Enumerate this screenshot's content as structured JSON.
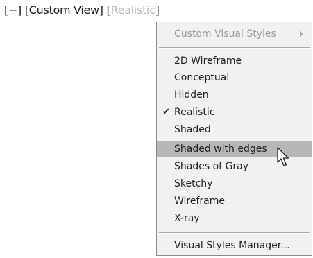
{
  "viewport_controls": {
    "minus": "[−]",
    "view": "[Custom View]",
    "style_open": "[",
    "style_name": "Realistic",
    "style_close": "]"
  },
  "menu": {
    "submenu": {
      "label": "Custom Visual Styles",
      "disabled": true,
      "icon": "chevron-right-icon"
    },
    "items": [
      {
        "label": "2D Wireframe"
      },
      {
        "label": "Conceptual"
      },
      {
        "label": "Hidden"
      },
      {
        "label": "Realistic",
        "checked": true
      },
      {
        "label": "Shaded"
      },
      {
        "label": "Shaded with edges",
        "highlighted": true
      },
      {
        "label": "Shades of Gray"
      },
      {
        "label": "Sketchy"
      },
      {
        "label": "Wireframe"
      },
      {
        "label": "X-ray"
      }
    ],
    "manager": {
      "label": "Visual Styles Manager..."
    }
  },
  "colors": {
    "menu_background": "#f1f1f1",
    "highlight": "#b7b7b7",
    "disabled_text": "#9a9a9a"
  }
}
